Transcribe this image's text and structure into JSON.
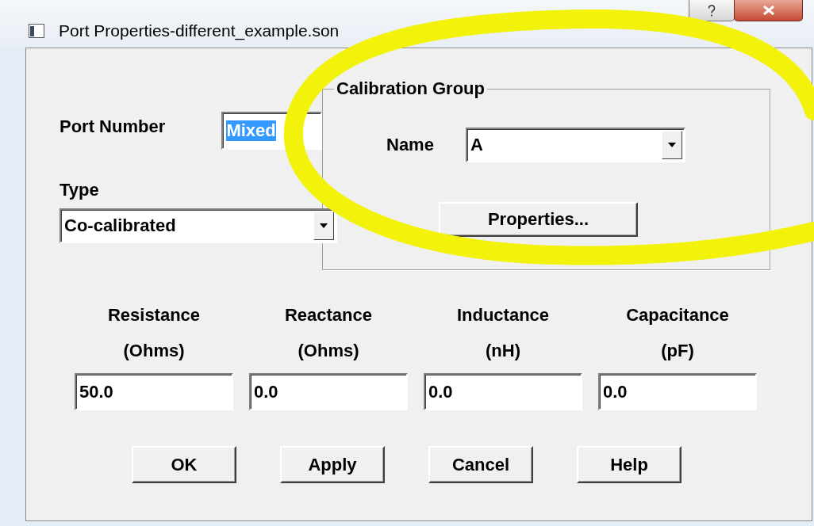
{
  "window": {
    "title": "Port Properties-different_example.son"
  },
  "port_number": {
    "label": "Port Number",
    "value": "Mixed",
    "selected": true
  },
  "type": {
    "label": "Type",
    "value": "Co-calibrated"
  },
  "calibration_group": {
    "title": "Calibration Group",
    "name_label": "Name",
    "name_value": "A",
    "properties_button": "Properties..."
  },
  "fields": [
    {
      "label": "Resistance",
      "unit": "(Ohms)",
      "value": "50.0"
    },
    {
      "label": "Reactance",
      "unit": "(Ohms)",
      "value": "0.0"
    },
    {
      "label": "Inductance",
      "unit": "(nH)",
      "value": "0.0"
    },
    {
      "label": "Capacitance",
      "unit": "(pF)",
      "value": "0.0"
    }
  ],
  "buttons": [
    "OK",
    "Apply",
    "Cancel",
    "Help"
  ]
}
